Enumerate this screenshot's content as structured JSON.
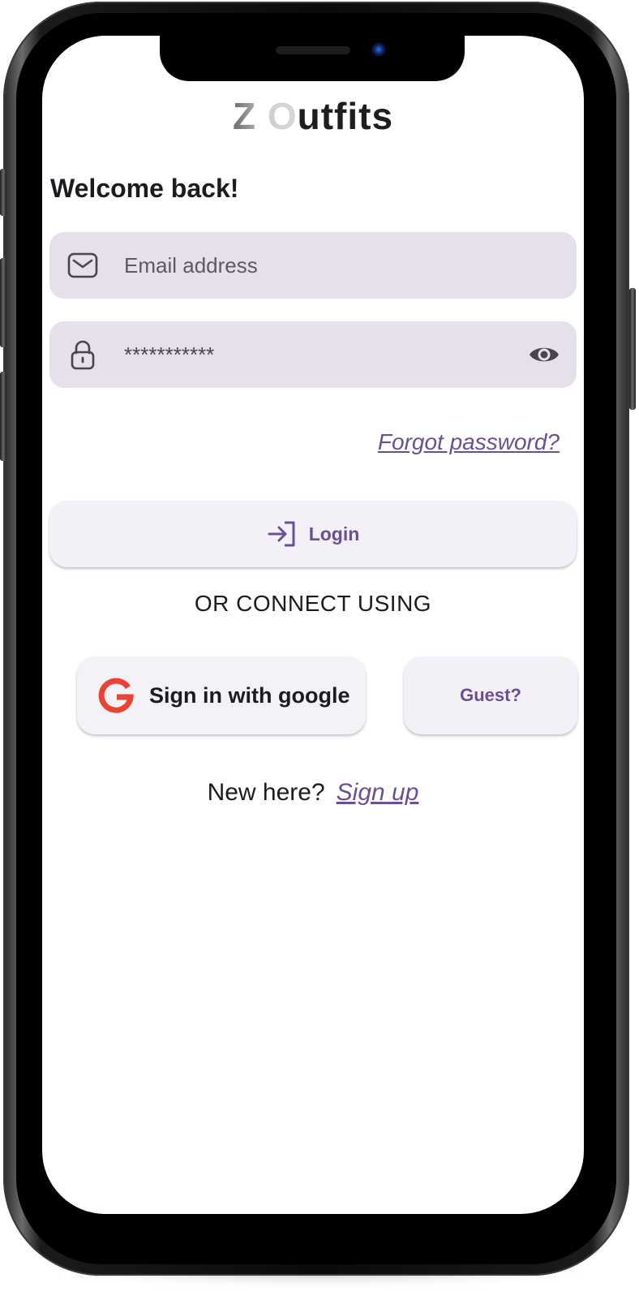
{
  "app": {
    "brand_prefix": "Z O",
    "brand_suffix": "utfits"
  },
  "login": {
    "welcome": "Welcome back!",
    "email_placeholder": "Email address",
    "password_value": "***********",
    "forgot_link": "Forgot password?",
    "login_label": "Login",
    "divider_text": "OR CONNECT USING",
    "google_label": "Sign in with google",
    "guest_label": "Guest?",
    "new_here": "New here?",
    "signup_link": "Sign up"
  },
  "icons": {
    "email": "mail-icon",
    "password": "lock-icon",
    "visibility": "eye-icon",
    "login": "login-arrow-icon",
    "google": "google-g-icon"
  },
  "colors": {
    "accent": "#6a4f96",
    "field_bg": "#e6dfec",
    "button_bg": "#f4f0f8",
    "google_red": "#ea4335"
  }
}
